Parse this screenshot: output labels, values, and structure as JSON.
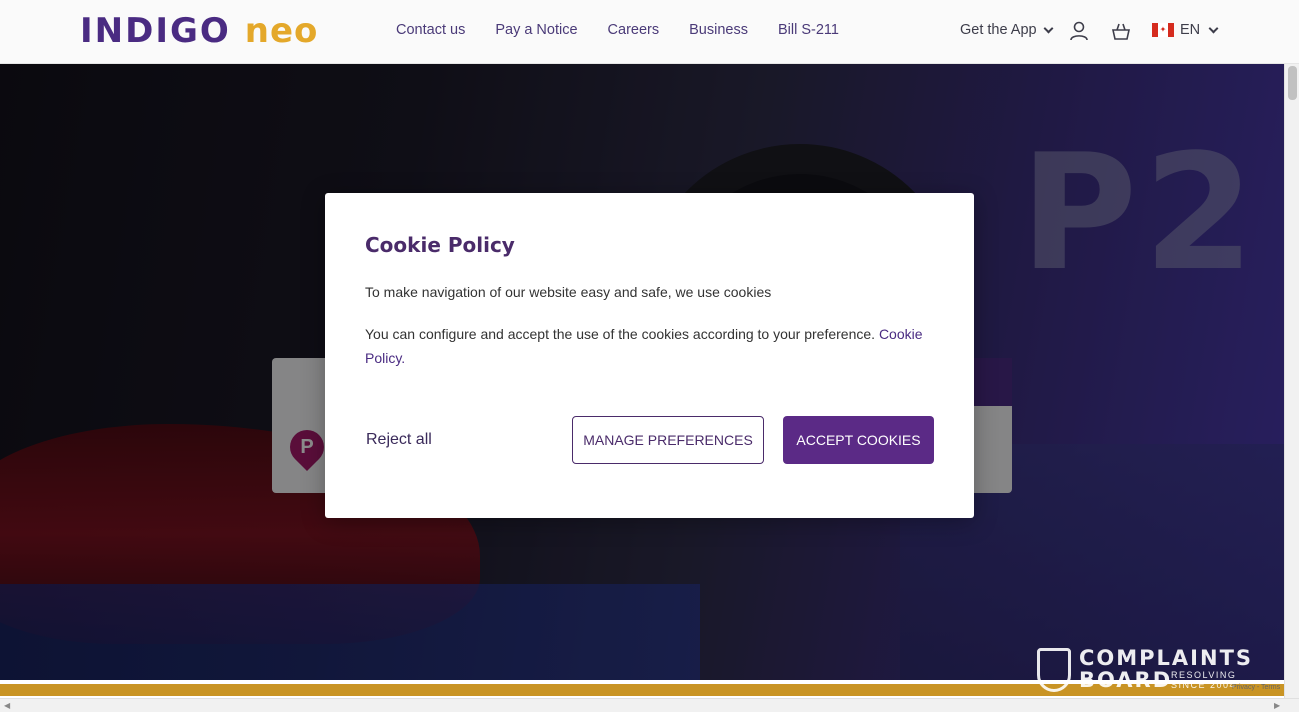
{
  "header": {
    "logo_part1": "INDIGO",
    "logo_part2": "neo",
    "nav": [
      "Contact us",
      "Pay a Notice",
      "Careers",
      "Business",
      "Bill S-211"
    ],
    "get_app": "Get the App",
    "language": "EN"
  },
  "hero": {
    "sign_text": "P2",
    "pin_letter": "P"
  },
  "modal": {
    "title": "Cookie Policy",
    "paragraph1": "To make navigation of our website easy and safe, we use cookies",
    "paragraph2_text": "You can configure and accept the use of the cookies according to your preference.",
    "paragraph2_link": "Cookie Policy.",
    "reject_label": "Reject all",
    "manage_label": "MANAGE PREFERENCES",
    "accept_label": "ACCEPT COOKIES"
  },
  "watermark": {
    "line1": "COMPLAINTS",
    "line2": "BOARD",
    "tag1": "RESOLVING",
    "tag2": "SINCE 2004"
  },
  "recaptcha": "Privacy - Terms",
  "colors": {
    "brand_purple": "#5b2a86",
    "brand_gold": "#e4a82a"
  }
}
